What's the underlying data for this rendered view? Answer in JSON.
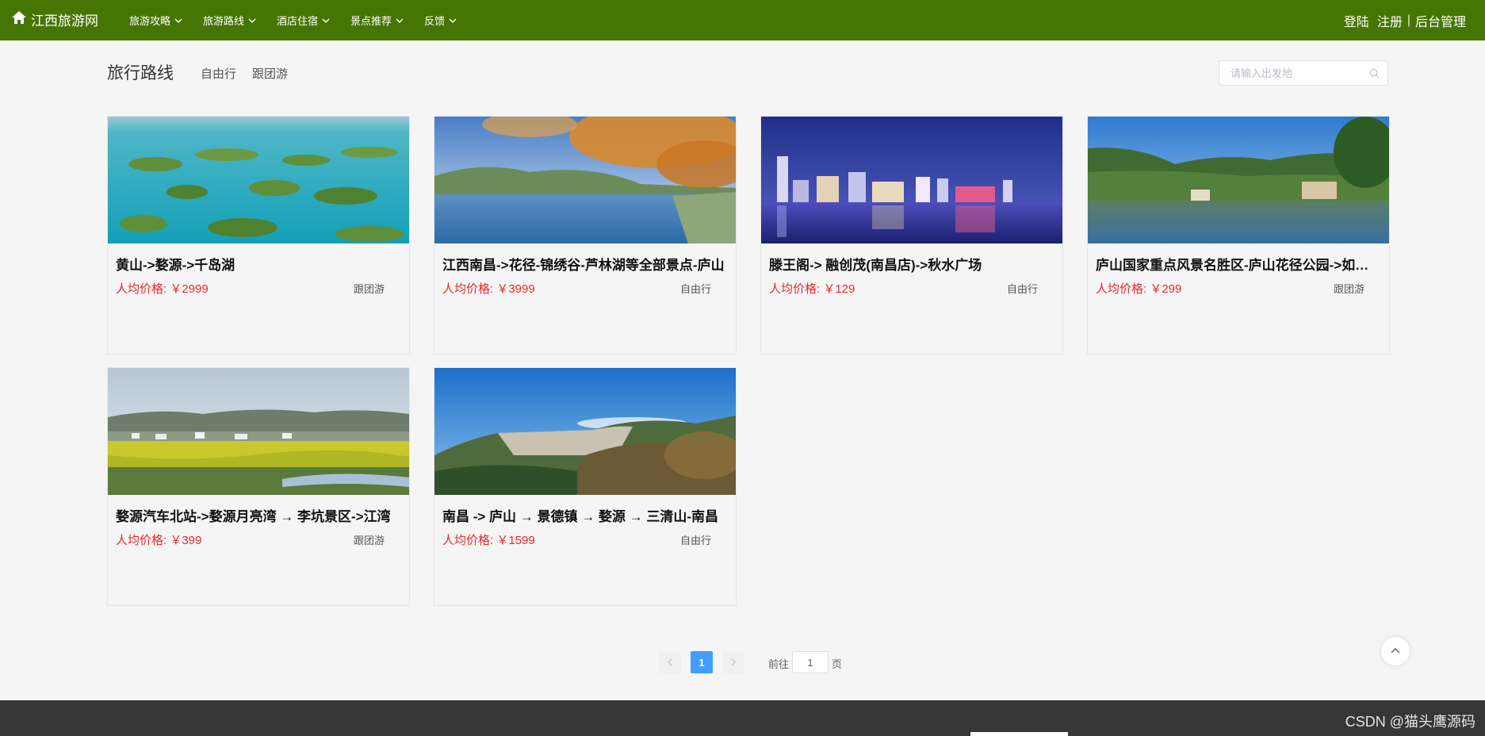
{
  "nav": {
    "brand": "江西旅游网",
    "menus": [
      "旅游攻略",
      "旅游路线",
      "酒店住宿",
      "景点推荐",
      "反馈"
    ],
    "login": "登陆",
    "register": "注册",
    "separator": "|",
    "admin": "后台管理"
  },
  "header": {
    "title": "旅行路线",
    "filters": [
      "自由行",
      "跟团游"
    ],
    "search_placeholder": "请输入出发地"
  },
  "price_prefix": "人均价格: ￥",
  "routes": [
    {
      "title": "黄山->婺源->千岛湖",
      "price": "2999",
      "type": "跟团游"
    },
    {
      "title": "江西南昌->花径-锦绣谷-芦林湖等全部景点-庐山",
      "price": "3999",
      "type": "自由行"
    },
    {
      "title": "滕王阁-> 融创茂(南昌店)->秋水广场",
      "price": "129",
      "type": "自由行"
    },
    {
      "title": "庐山国家重点风景名胜区-庐山花径公园->如琴湖",
      "price": "299",
      "type": "跟团游"
    },
    {
      "title": "婺源汽车北站->婺源月亮湾 → 李坑景区->江湾",
      "price": "399",
      "type": "跟团游"
    },
    {
      "title": "南昌 -> 庐山 → 景德镇 → 婺源 → 三清山-南昌",
      "price": "1599",
      "type": "自由行"
    }
  ],
  "pagination": {
    "current": "1",
    "goto_label": "前往",
    "goto_value": "1",
    "page_unit": "页"
  },
  "footer": {
    "watermark": "CSDN @猫头鹰源码"
  },
  "colors": {
    "nav_bg": "#467503",
    "price": "#e8282b",
    "page_active": "#409eff",
    "footer_bg": "#363636"
  }
}
